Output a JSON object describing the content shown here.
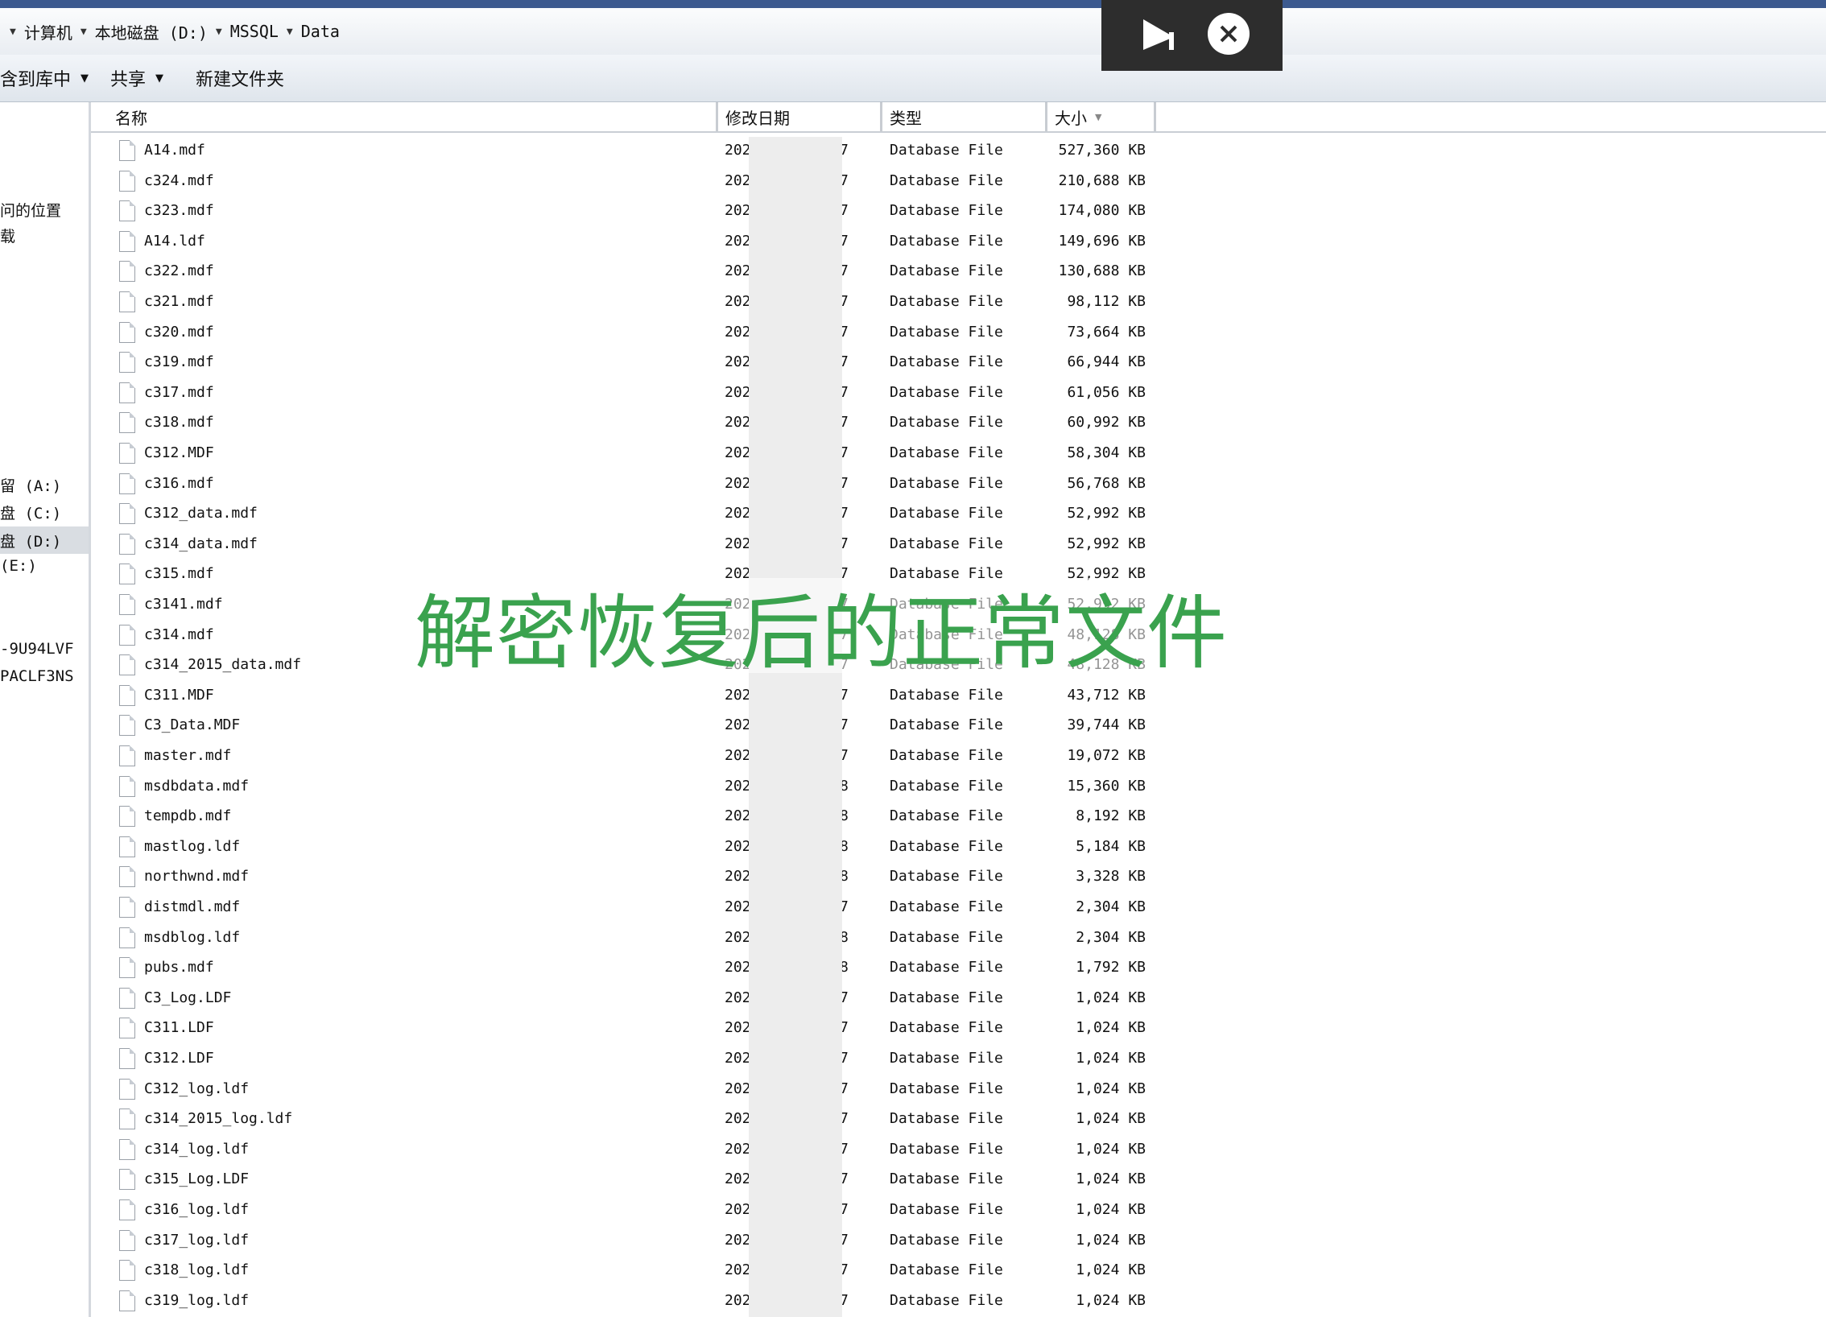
{
  "breadcrumb": [
    "计算机",
    "本地磁盘 (D:)",
    "MSSQL",
    "Data"
  ],
  "toolbar": {
    "include_library": "含到库中",
    "share": "共享",
    "new_folder": "新建文件夹"
  },
  "sidebar": {
    "items": [
      "问的位置",
      "载",
      "留 (A:)",
      "盘 (C:)",
      "盘 (D:)",
      "(E:)",
      "-9U94LVF",
      "PACLF3NS"
    ]
  },
  "columns": {
    "name": "名称",
    "date": "修改日期",
    "type": "类型",
    "size": "大小"
  },
  "files": [
    {
      "name": "A14.mdf",
      "date": "202",
      "date_tail": "7",
      "type": "Database File",
      "size": "527,360 KB"
    },
    {
      "name": "c324.mdf",
      "date": "202",
      "date_tail": "7",
      "type": "Database File",
      "size": "210,688 KB"
    },
    {
      "name": "c323.mdf",
      "date": "202",
      "date_tail": "7",
      "type": "Database File",
      "size": "174,080 KB"
    },
    {
      "name": "A14.ldf",
      "date": "202",
      "date_tail": "7",
      "type": "Database File",
      "size": "149,696 KB"
    },
    {
      "name": "c322.mdf",
      "date": "202",
      "date_tail": "7",
      "type": "Database File",
      "size": "130,688 KB"
    },
    {
      "name": "c321.mdf",
      "date": "202",
      "date_tail": "7",
      "type": "Database File",
      "size": "98,112 KB"
    },
    {
      "name": "c320.mdf",
      "date": "202",
      "date_tail": "7",
      "type": "Database File",
      "size": "73,664 KB"
    },
    {
      "name": "c319.mdf",
      "date": "202",
      "date_tail": "7",
      "type": "Database File",
      "size": "66,944 KB"
    },
    {
      "name": "c317.mdf",
      "date": "202",
      "date_tail": "7",
      "type": "Database File",
      "size": "61,056 KB"
    },
    {
      "name": "c318.mdf",
      "date": "202",
      "date_tail": "7",
      "type": "Database File",
      "size": "60,992 KB"
    },
    {
      "name": "C312.MDF",
      "date": "202",
      "date_tail": "7",
      "type": "Database File",
      "size": "58,304 KB"
    },
    {
      "name": "c316.mdf",
      "date": "202",
      "date_tail": "7",
      "type": "Database File",
      "size": "56,768 KB"
    },
    {
      "name": "C312_data.mdf",
      "date": "202",
      "date_tail": "7",
      "type": "Database File",
      "size": "52,992 KB"
    },
    {
      "name": "c314_data.mdf",
      "date": "202",
      "date_tail": "7",
      "type": "Database File",
      "size": "52,992 KB"
    },
    {
      "name": "c315.mdf",
      "date": "202",
      "date_tail": "7",
      "type": "Database File",
      "size": "52,992 KB"
    },
    {
      "name": "c3141.mdf",
      "date": "202",
      "date_tail": "7",
      "type": "Database File",
      "size": "52,992 KB"
    },
    {
      "name": "c314.mdf",
      "date": "202",
      "date_tail": "7",
      "type": "Database File",
      "size": "48,128 KB"
    },
    {
      "name": "c314_2015_data.mdf",
      "date": "202",
      "date_tail": "7",
      "type": "Database File",
      "size": "48,128 KB"
    },
    {
      "name": "C311.MDF",
      "date": "202",
      "date_tail": "7",
      "type": "Database File",
      "size": "43,712 KB"
    },
    {
      "name": "C3_Data.MDF",
      "date": "202",
      "date_tail": "7",
      "type": "Database File",
      "size": "39,744 KB"
    },
    {
      "name": "master.mdf",
      "date": "202",
      "date_tail": "7",
      "type": "Database File",
      "size": "19,072 KB"
    },
    {
      "name": "msdbdata.mdf",
      "date": "202",
      "date_tail": "8",
      "type": "Database File",
      "size": "15,360 KB"
    },
    {
      "name": "tempdb.mdf",
      "date": "202",
      "date_tail": "8",
      "type": "Database File",
      "size": "8,192 KB"
    },
    {
      "name": "mastlog.ldf",
      "date": "202",
      "date_tail": "8",
      "type": "Database File",
      "size": "5,184 KB"
    },
    {
      "name": "northwnd.mdf",
      "date": "202",
      "date_tail": "8",
      "type": "Database File",
      "size": "3,328 KB"
    },
    {
      "name": "distmdl.mdf",
      "date": "202",
      "date_tail": "7",
      "type": "Database File",
      "size": "2,304 KB"
    },
    {
      "name": "msdblog.ldf",
      "date": "202",
      "date_tail": "8",
      "type": "Database File",
      "size": "2,304 KB"
    },
    {
      "name": "pubs.mdf",
      "date": "202",
      "date_tail": "8",
      "type": "Database File",
      "size": "1,792 KB"
    },
    {
      "name": "C3_Log.LDF",
      "date": "202",
      "date_tail": "7",
      "type": "Database File",
      "size": "1,024 KB"
    },
    {
      "name": "C311.LDF",
      "date": "202",
      "date_tail": "7",
      "type": "Database File",
      "size": "1,024 KB"
    },
    {
      "name": "C312.LDF",
      "date": "202",
      "date_tail": "7",
      "type": "Database File",
      "size": "1,024 KB"
    },
    {
      "name": "C312_log.ldf",
      "date": "202",
      "date_tail": "7",
      "type": "Database File",
      "size": "1,024 KB"
    },
    {
      "name": "c314_2015_log.ldf",
      "date": "202",
      "date_tail": "7",
      "type": "Database File",
      "size": "1,024 KB"
    },
    {
      "name": "c314_log.ldf",
      "date": "202",
      "date_tail": "7",
      "type": "Database File",
      "size": "1,024 KB"
    },
    {
      "name": "c315_Log.LDF",
      "date": "202",
      "date_tail": "7",
      "type": "Database File",
      "size": "1,024 KB"
    },
    {
      "name": "c316_log.ldf",
      "date": "202",
      "date_tail": "7",
      "type": "Database File",
      "size": "1,024 KB"
    },
    {
      "name": "c317_log.ldf",
      "date": "202",
      "date_tail": "7",
      "type": "Database File",
      "size": "1,024 KB"
    },
    {
      "name": "c318_log.ldf",
      "date": "202",
      "date_tail": "7",
      "type": "Database File",
      "size": "1,024 KB"
    },
    {
      "name": "c319_log.ldf",
      "date": "202",
      "date_tail": "7",
      "type": "Database File",
      "size": "1,024 KB"
    }
  ],
  "caption": "解密恢复后的正常文件",
  "overlay": {
    "play_icon": "play-icon",
    "close_icon": "close-icon"
  },
  "colors": {
    "caption": "#3aa24e",
    "overlay_bg": "#2d2d2d",
    "title_strip": "#3c5a8f"
  }
}
